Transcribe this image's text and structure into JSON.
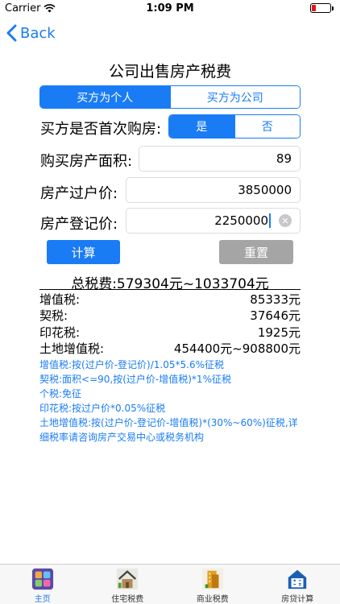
{
  "status": {
    "carrier": "Carrier",
    "time": "1:09 PM"
  },
  "nav": {
    "back_label": "Back"
  },
  "title": "公司出售房产税费",
  "buyer_type": {
    "options": [
      "买方为个人",
      "买方为公司"
    ],
    "selected": 0
  },
  "first_home": {
    "label": "买方是否首次购房:",
    "options": [
      "是",
      "否"
    ],
    "selected": 0
  },
  "area": {
    "label": "购买房产面积:",
    "value": "89"
  },
  "transfer_price": {
    "label": "房产过户价:",
    "value": "3850000"
  },
  "registered_price": {
    "label": "房产登记价:",
    "value": "2250000"
  },
  "buttons": {
    "calculate": "计算",
    "reset": "重置"
  },
  "total": "总税费:579304元~1033704元",
  "results": [
    {
      "label": "增值税:",
      "value": "85333元"
    },
    {
      "label": "契税:",
      "value": "37646元"
    },
    {
      "label": "印花税:",
      "value": "1925元"
    },
    {
      "label": "土地增值税:",
      "value": "454400元~908800元"
    }
  ],
  "notes": [
    "增值税:按(过户价-登记价)/1.05*5.6%征税",
    "契税:面积<=90,按(过户价-增值税)*1%征税",
    "个税:免征",
    "印花税:按过户价*0.05%征税",
    "土地增值税:按(过户价-登记价-增值税)*(30%~60%)征税,详细税率请咨询房产交易中心或税务机构"
  ],
  "tabs": [
    {
      "label": "主页",
      "icon": "home-grid-icon"
    },
    {
      "label": "住宅税费",
      "icon": "house-icon"
    },
    {
      "label": "商业税费",
      "icon": "commercial-building-icon"
    },
    {
      "label": "房贷计算",
      "icon": "calculator-house-icon"
    }
  ],
  "colors": {
    "accent": "#1a7cf5",
    "reset": "#a5a5a5",
    "battery": "#e0181b"
  }
}
